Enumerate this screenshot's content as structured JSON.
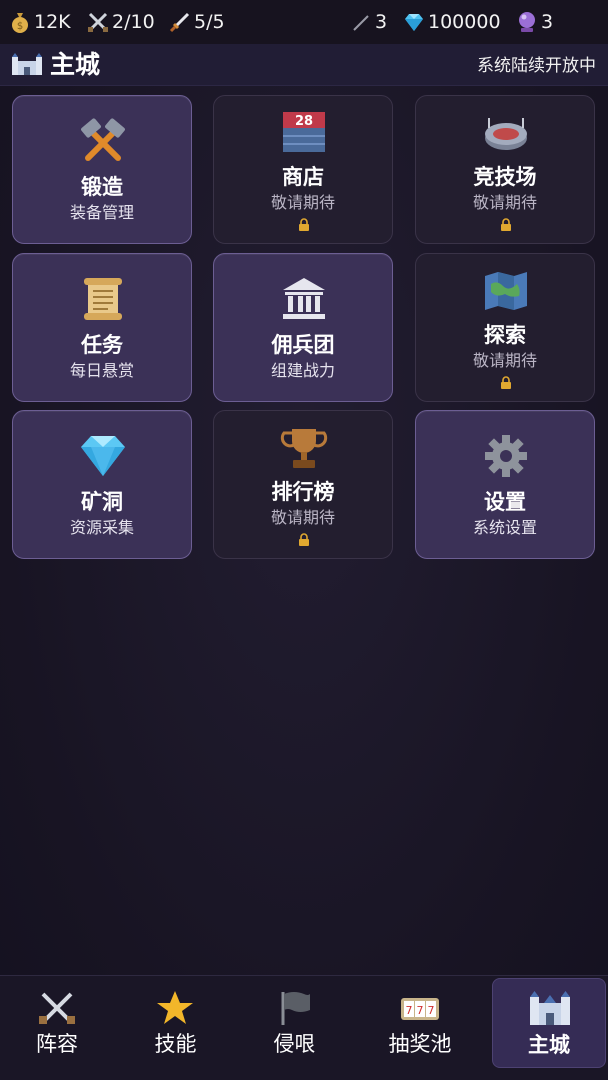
{
  "resources": {
    "gold": "12K",
    "swords": "2/10",
    "daggers": "5/5",
    "stick": "3",
    "gems": "100000",
    "orbs": "3"
  },
  "header": {
    "title": "主城",
    "note": "系统陆续开放中"
  },
  "cards": [
    {
      "name": "锻造",
      "sub": "装备管理",
      "icon": "hammers-icon",
      "locked": false
    },
    {
      "name": "商店",
      "sub": "敬请期待",
      "icon": "calendar-shop-icon",
      "badge": "28",
      "locked": true
    },
    {
      "name": "竞技场",
      "sub": "敬请期待",
      "icon": "stadium-icon",
      "locked": true
    },
    {
      "name": "任务",
      "sub": "每日悬赏",
      "icon": "scroll-icon",
      "locked": false
    },
    {
      "name": "佣兵团",
      "sub": "组建战力",
      "icon": "bank-icon",
      "locked": false
    },
    {
      "name": "探索",
      "sub": "敬请期待",
      "icon": "map-icon",
      "locked": true
    },
    {
      "name": "矿洞",
      "sub": "资源采集",
      "icon": "diamond-icon",
      "locked": false
    },
    {
      "name": "排行榜",
      "sub": "敬请期待",
      "icon": "trophy-icon",
      "locked": true
    },
    {
      "name": "设置",
      "sub": "系统设置",
      "icon": "gear-icon",
      "locked": false
    }
  ],
  "nav": [
    {
      "label": "阵容",
      "icon": "crossed-swords-icon"
    },
    {
      "label": "技能",
      "icon": "star-icon"
    },
    {
      "label": "侵哏",
      "icon": "flag-icon"
    },
    {
      "label": "抽奖池",
      "icon": "slot-machine-icon"
    },
    {
      "label": "主城",
      "icon": "castle-icon",
      "active": true
    }
  ],
  "colors": {
    "background": "#181423",
    "card_active": "#3b3157",
    "card_locked": "#231e2f",
    "nav_active": "#352c55"
  }
}
